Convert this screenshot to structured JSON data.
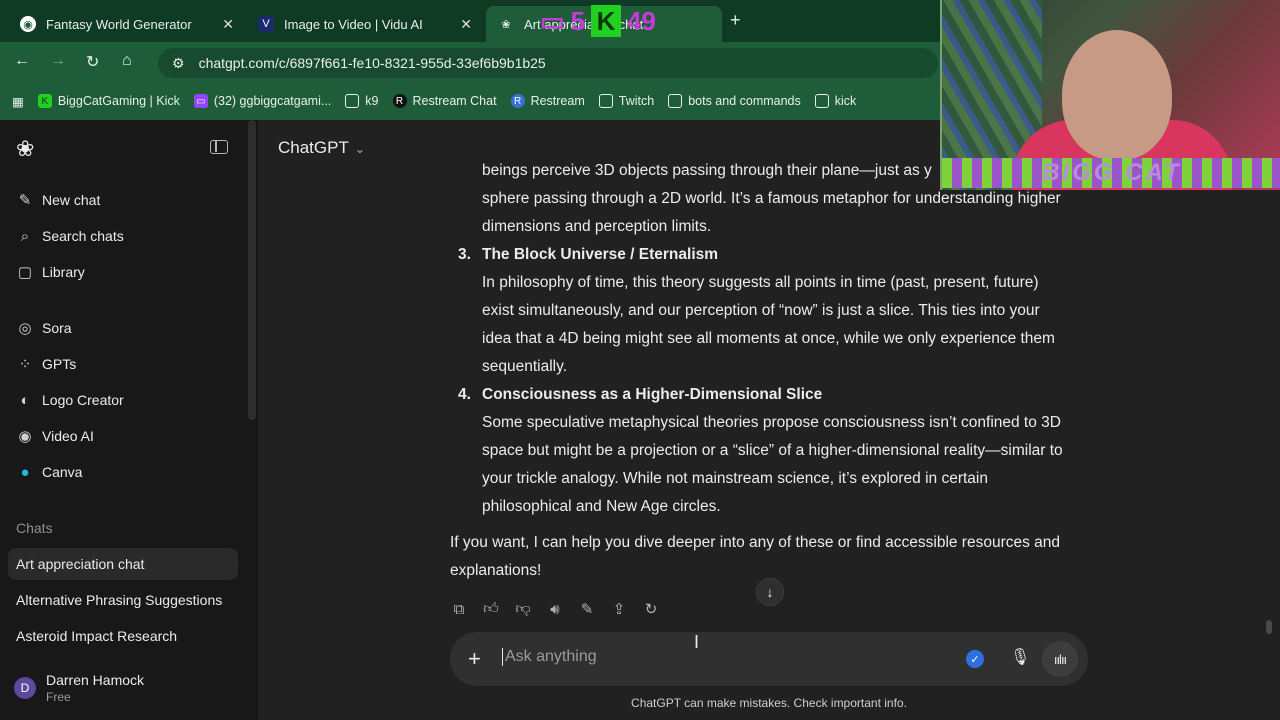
{
  "browser": {
    "tabs": [
      {
        "title": "Fantasy World Generator",
        "icon": "globe-icon"
      },
      {
        "title": "Image to Video | Vidu AI",
        "icon": "vidu-icon"
      },
      {
        "title": "Art appreciation chat",
        "icon": "chatgpt-icon"
      }
    ],
    "url": "chatgpt.com/c/6897f661-fe10-8321-955d-33ef6b9b1b25",
    "bookmarks": [
      {
        "label": "BiggCatGaming | Kick",
        "icon": "kick-icon"
      },
      {
        "label": "(32) ggbiggcatgami...",
        "icon": "twitch-icon"
      },
      {
        "label": "k9",
        "icon": "folder-icon"
      },
      {
        "label": "Restream Chat",
        "icon": "restream-icon"
      },
      {
        "label": "Restream",
        "icon": "restream-icon"
      },
      {
        "label": "Twitch",
        "icon": "folder-icon"
      },
      {
        "label": "bots and commands",
        "icon": "folder-icon"
      },
      {
        "label": "kick",
        "icon": "folder-icon"
      }
    ]
  },
  "overlay": {
    "twitch_count": "5",
    "kick_count": "49",
    "banner": "BIGG CAT"
  },
  "sidebar": {
    "nav": [
      {
        "label": "New chat",
        "icon": "compose-icon"
      },
      {
        "label": "Search chats",
        "icon": "search-icon"
      },
      {
        "label": "Library",
        "icon": "library-icon"
      }
    ],
    "apps": [
      {
        "label": "Sora",
        "icon": "sora-icon"
      },
      {
        "label": "GPTs",
        "icon": "gpts-icon"
      },
      {
        "label": "Logo Creator",
        "icon": "logo-creator-icon"
      },
      {
        "label": "Video AI",
        "icon": "video-ai-icon"
      },
      {
        "label": "Canva",
        "icon": "canva-icon"
      }
    ],
    "section_title": "Chats",
    "chats": [
      "Art appreciation chat",
      "Alternative Phrasing Suggestions",
      "Asteroid Impact Research"
    ],
    "user": {
      "initial": "D",
      "name": "Darren Hamock",
      "plan": "Free"
    }
  },
  "main": {
    "model": "ChatGPT",
    "lines": {
      "l0": "beings perceive 3D objects passing through their plane—just as y",
      "l1": "sphere passing through a 2D world. It’s a famous metaphor for understanding higher",
      "l2": "dimensions and perception limits.",
      "item3_num": "3.",
      "item3_title": "The Block Universe / Eternalism",
      "l3": "In philosophy of time, this theory suggests all points in time (past, present, future)",
      "l4": "exist simultaneously, and our perception of “now” is just a slice. This ties into your",
      "l5": "idea that a 4D being might see all moments at once, while we only experience them",
      "l6": "sequentially.",
      "item4_num": "4.",
      "item4_title": "Consciousness as a Higher-Dimensional Slice",
      "l7": "Some speculative metaphysical theories propose consciousness isn’t confined to 3D",
      "l8": "space but might be a projection or a “slice” of a higher-dimensional reality—similar to",
      "l9": "your trickle analogy. While not mainstream science, it’s explored in certain",
      "l10": "philosophical and New Age circles.",
      "l11": "If you want, I can help you dive deeper into any of these or find accessible resources and",
      "l12": "explanations!"
    },
    "composer_placeholder": "Ask anything",
    "footnote": "ChatGPT can make mistakes. Check important info."
  }
}
